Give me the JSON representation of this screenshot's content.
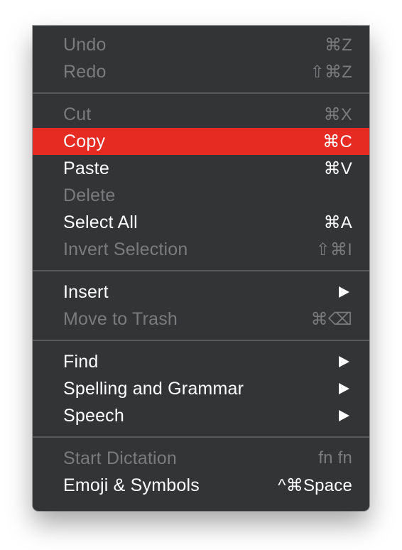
{
  "menu": {
    "sections": [
      {
        "items": [
          {
            "label": "Undo",
            "shortcut": "⌘Z",
            "enabled": false
          },
          {
            "label": "Redo",
            "shortcut": "⇧⌘Z",
            "enabled": false
          }
        ]
      },
      {
        "items": [
          {
            "label": "Cut",
            "shortcut": "⌘X",
            "enabled": false
          },
          {
            "label": "Copy",
            "shortcut": "⌘C",
            "enabled": true,
            "highlighted": true
          },
          {
            "label": "Paste",
            "shortcut": "⌘V",
            "enabled": true
          },
          {
            "label": "Delete",
            "shortcut": "",
            "enabled": false
          },
          {
            "label": "Select All",
            "shortcut": "⌘A",
            "enabled": true
          },
          {
            "label": "Invert Selection",
            "shortcut": "⇧⌘I",
            "enabled": false
          }
        ]
      },
      {
        "items": [
          {
            "label": "Insert",
            "submenu": true,
            "enabled": true
          },
          {
            "label": "Move to Trash",
            "shortcut": "⌘⌫",
            "enabled": false
          }
        ]
      },
      {
        "items": [
          {
            "label": "Find",
            "submenu": true,
            "enabled": true
          },
          {
            "label": "Spelling and Grammar",
            "submenu": true,
            "enabled": true
          },
          {
            "label": "Speech",
            "submenu": true,
            "enabled": true
          }
        ]
      },
      {
        "items": [
          {
            "label": "Start Dictation",
            "shortcut": "fn fn",
            "enabled": false
          },
          {
            "label": "Emoji & Symbols",
            "shortcut": "^⌘Space",
            "enabled": true
          }
        ]
      }
    ]
  },
  "colors": {
    "menu_background": "#333436",
    "highlight": "#e62b22",
    "text_enabled": "#ffffff",
    "text_disabled": "#7a7b7d",
    "separator": "#58595b"
  },
  "icons": {
    "submenu": "submenu-arrow-icon"
  }
}
